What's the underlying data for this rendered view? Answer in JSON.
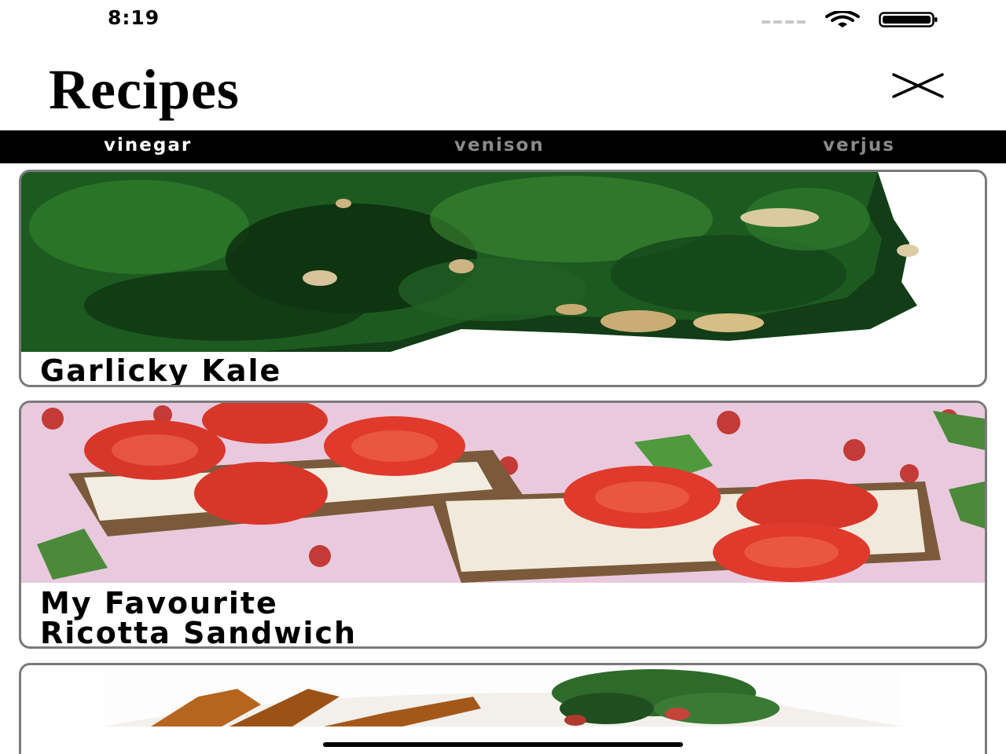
{
  "status_bar": {
    "time": "8:19",
    "signal_icon": "cellular-signal-icon",
    "wifi_icon": "wifi-icon",
    "battery_icon": "battery-icon"
  },
  "header": {
    "title": "Recipes",
    "close_icon": "close-icon"
  },
  "tabs": [
    {
      "label": "vinegar",
      "active": true
    },
    {
      "label": "venison",
      "active": false
    },
    {
      "label": "verjus",
      "active": false
    }
  ],
  "recipes": [
    {
      "title": "Garlicky Kale",
      "image": "kale-photo"
    },
    {
      "title": "My Favourite\nRicotta Sandwich",
      "image": "strawberry-ricotta-photo"
    },
    {
      "title": "",
      "image": "potato-wedges-salad-photo"
    }
  ],
  "colors": {
    "tab_bar_bg": "#000000",
    "tab_active": "#ffffff",
    "tab_inactive": "#8a8a8a",
    "card_border": "#7a7a7a"
  }
}
